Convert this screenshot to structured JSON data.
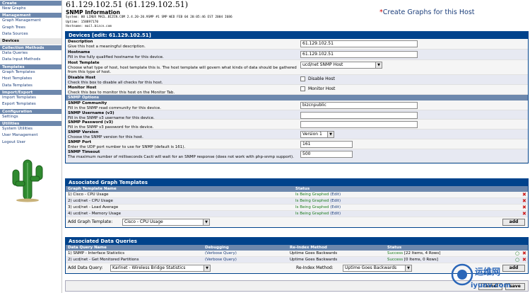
{
  "sidebar": {
    "sections": [
      {
        "title": "Create",
        "items": [
          {
            "label": "New Graphs",
            "active": false
          }
        ]
      },
      {
        "title": "Management",
        "items": [
          {
            "label": "Graph Management",
            "active": false
          },
          {
            "label": "Graph Trees",
            "active": false
          },
          {
            "label": "Data Sources",
            "active": false
          },
          {
            "label": "Devices",
            "active": true
          }
        ]
      },
      {
        "title": "Collection Methods",
        "items": [
          {
            "label": "Data Queries",
            "active": false
          },
          {
            "label": "Data Input Methods",
            "active": false
          }
        ]
      },
      {
        "title": "Templates",
        "items": [
          {
            "label": "Graph Templates",
            "active": false
          },
          {
            "label": "Host Templates",
            "active": false
          },
          {
            "label": "Data Templates",
            "active": false
          }
        ]
      },
      {
        "title": "Import/Export",
        "items": [
          {
            "label": "Import Templates",
            "active": false
          },
          {
            "label": "Export Templates",
            "active": false
          }
        ]
      },
      {
        "title": "Configuration",
        "items": [
          {
            "label": "Settings",
            "active": false
          }
        ]
      },
      {
        "title": "Utilities",
        "items": [
          {
            "label": "System Utilities",
            "active": false
          },
          {
            "label": "User Management",
            "active": false
          },
          {
            "label": "Logout User",
            "active": false
          }
        ]
      }
    ]
  },
  "header": {
    "device_title": "61.129.102.51 (61.129.102.51)",
    "snmp_title": "SNMP Information",
    "system_line": "System: 00 LINUX MAIL.BIZCN.COM 2.4.20-20.9SMP #1 SMP WED FEB 04 20:05:46 EST 2004 I686",
    "uptime_line": "Uptime: 158897170",
    "hostname_line": "Hostname: mail.bizcn.com",
    "create_graphs_star": "*",
    "create_graphs_link": "Create Graphs for this Host"
  },
  "devices": {
    "panel_title": "Devices [edit: 61.129.102.51]",
    "fields": [
      {
        "label": "Description",
        "help": "Give this host a meaningful description.",
        "type": "text",
        "value": "61.129.102.51"
      },
      {
        "label": "Hostname",
        "help": "Fill in the fully qualified hostname for this device.",
        "type": "text",
        "value": "61.129.102.51"
      },
      {
        "label": "Host Template",
        "help": "Choose what type of host, host template this is. The host template will govern what kinds of data should be gathered from this type of host.",
        "type": "select",
        "value": "ucd/net SNMP Host"
      },
      {
        "label": "Disable Host",
        "help": "Check this box to disable all checks for this host.",
        "type": "checkbox",
        "value": "Disable Host"
      },
      {
        "label": "Monitor Host",
        "help": "Check this box to monitor this host on the Monitor Tab.",
        "type": "checkbox",
        "value": "Monitor Host"
      }
    ],
    "snmp_section_title": "SNMP Options",
    "snmp_fields": [
      {
        "label": "SNMP Community",
        "help": "Fill in the SNMP read community for this device.",
        "type": "text",
        "value": "bizcnpublic"
      },
      {
        "label": "SNMP Username (v3)",
        "help": "Fill in the SNMP v3 username for this device.",
        "type": "text",
        "value": ""
      },
      {
        "label": "SNMP Password (v3)",
        "help": "Fill in the SNMP v3 password for this device.",
        "type": "text",
        "value": ""
      },
      {
        "label": "SNMP Version",
        "help": "Choose the SNMP version for this host.",
        "type": "select",
        "value": "Version 1"
      },
      {
        "label": "SNMP Port",
        "help": "Enter the UDP port number to use for SNMP (default is 161).",
        "type": "text",
        "value": "161"
      },
      {
        "label": "SNMP Timeout",
        "help": "The maximum number of milliseconds Cacti will wait for an SNMP response (does not work with php-snmp support).",
        "type": "text",
        "value": "500"
      }
    ]
  },
  "graph_templates": {
    "panel_title": "Associated Graph Templates",
    "columns": {
      "name": "Graph Template Name",
      "status": "Status"
    },
    "rows": [
      {
        "name": "1) Cisco - CPU Usage",
        "status": "Is Being Graphed",
        "edit": "(Edit)"
      },
      {
        "name": "2) ucd/net - CPU Usage",
        "status": "Is Being Graphed",
        "edit": "(Edit)"
      },
      {
        "name": "3) ucd/net - Load Average",
        "status": "Is Being Graphed",
        "edit": "(Edit)"
      },
      {
        "name": "4) ucd/net - Memory Usage",
        "status": "Is Being Graphed",
        "edit": "(Edit)"
      }
    ],
    "add_label": "Add Graph Template:",
    "add_value": "Cisco - CPU Usage",
    "add_button": "add"
  },
  "data_queries": {
    "panel_title": "Associated Data Queries",
    "columns": {
      "name": "Data Query Name",
      "debugging": "Debugging",
      "reindex": "Re-Index Method",
      "status": "Status"
    },
    "rows": [
      {
        "name": "1) SNMP - Interface Statistics",
        "debug": "(Verbose Query)",
        "reindex": "Uptime Goes Backwards",
        "status": "Success",
        "detail": "[22 Items, 4 Rows]"
      },
      {
        "name": "2) ucd/net - Get Monitored Partitions",
        "debug": "(Verbose Query)",
        "reindex": "Uptime Goes Backwards",
        "status": "Success",
        "detail": "[0 Items, 0 Rows]"
      }
    ],
    "add_label": "Add Data Query:",
    "add_value": "Karlnet - Wireless Bridge Statistics",
    "reindex_label": "Re-Index Method:",
    "reindex_value": "Uptime Goes Backwards",
    "add_button": "add"
  },
  "save_bar": {
    "cancel": "cancel",
    "save": "save"
  },
  "watermark": {
    "text_cn": "运维网",
    "text_url": "iyunv.com"
  },
  "colors": {
    "header_blue": "#00438c",
    "subhead_blue": "#6d88ad",
    "link_blue": "#1a3d7a",
    "success_green": "#1a7a1a",
    "delete_red": "#cc1f1f"
  }
}
